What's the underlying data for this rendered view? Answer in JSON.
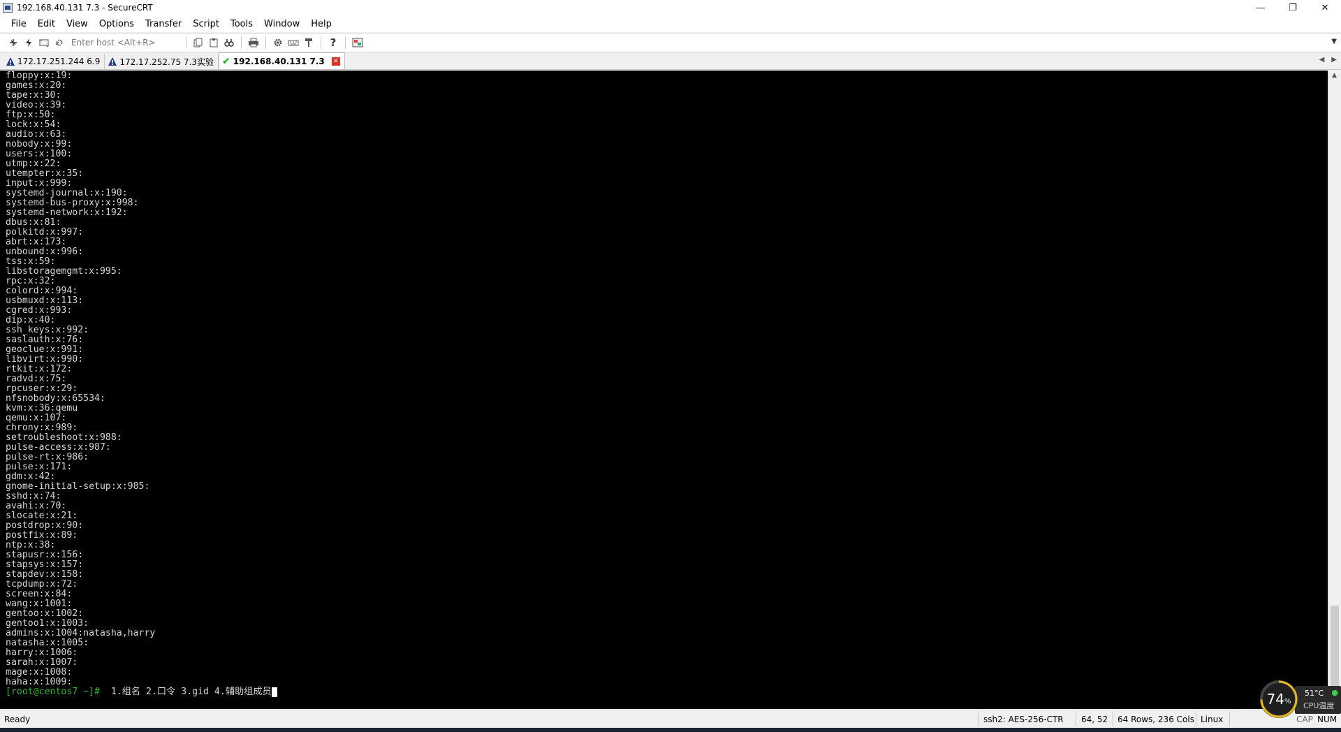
{
  "window": {
    "title": "192.168.40.131 7.3 - SecureCRT",
    "controls": {
      "minimize": "—",
      "maximize": "❐",
      "close": "✕"
    }
  },
  "menu": [
    "File",
    "Edit",
    "View",
    "Options",
    "Transfer",
    "Script",
    "Tools",
    "Window",
    "Help"
  ],
  "toolbar": {
    "host_placeholder": "Enter host <Alt+R>",
    "icons": [
      "connect-bar-icon",
      "quick-connect-icon",
      "reconnect-icon",
      "disconnect-icon",
      "copy-icon",
      "paste-icon",
      "find-icon",
      "print-icon",
      "settings-icon",
      "keymap-icon",
      "sftp-icon",
      "help-icon",
      "screen-icon"
    ]
  },
  "tabs": [
    {
      "label": "172.17.251.244 6.9",
      "status": "warning",
      "active": false
    },
    {
      "label": "172.17.252.75 7.3实验",
      "status": "warning",
      "active": false
    },
    {
      "label": "192.168.40.131 7.3",
      "status": "connected",
      "active": true
    }
  ],
  "terminal": {
    "lines": [
      "floppy:x:19:",
      "games:x:20:",
      "tape:x:30:",
      "video:x:39:",
      "ftp:x:50:",
      "lock:x:54:",
      "audio:x:63:",
      "nobody:x:99:",
      "users:x:100:",
      "utmp:x:22:",
      "utempter:x:35:",
      "input:x:999:",
      "systemd-journal:x:190:",
      "systemd-bus-proxy:x:998:",
      "systemd-network:x:192:",
      "dbus:x:81:",
      "polkitd:x:997:",
      "abrt:x:173:",
      "unbound:x:996:",
      "tss:x:59:",
      "libstoragemgmt:x:995:",
      "rpc:x:32:",
      "colord:x:994:",
      "usbmuxd:x:113:",
      "cgred:x:993:",
      "dip:x:40:",
      "ssh_keys:x:992:",
      "saslauth:x:76:",
      "geoclue:x:991:",
      "libvirt:x:990:",
      "rtkit:x:172:",
      "radvd:x:75:",
      "rpcuser:x:29:",
      "nfsnobody:x:65534:",
      "kvm:x:36:qemu",
      "qemu:x:107:",
      "chrony:x:989:",
      "setroubleshoot:x:988:",
      "pulse-access:x:987:",
      "pulse-rt:x:986:",
      "pulse:x:171:",
      "gdm:x:42:",
      "gnome-initial-setup:x:985:",
      "sshd:x:74:",
      "avahi:x:70:",
      "slocate:x:21:",
      "postdrop:x:90:",
      "postfix:x:89:",
      "ntp:x:38:",
      "stapusr:x:156:",
      "stapsys:x:157:",
      "stapdev:x:158:",
      "tcpdump:x:72:",
      "screen:x:84:",
      "wang:x:1001:",
      "gentoo:x:1002:",
      "gentoo1:x:1003:",
      "admins:x:1004:natasha,harry",
      "natasha:x:1005:",
      "harry:x:1006:",
      "sarah:x:1007:",
      "mage:x:1008:",
      "haha:x:1009:"
    ],
    "prompt": "[root@centos7 ~]#",
    "command": "  1.组名 2.口令 3.gid 4.辅助组成员"
  },
  "status": {
    "ready": "Ready",
    "cipher": "ssh2: AES-256-CTR",
    "cursor_pos": "64,  52",
    "dimensions": "64 Rows, 236 Cols",
    "os": "Linux",
    "cap": "CAP",
    "num": "NUM"
  },
  "cpu_widget": {
    "percent": "74",
    "percent_sign": "%",
    "temperature": "51°C",
    "label": "CPU温度"
  }
}
